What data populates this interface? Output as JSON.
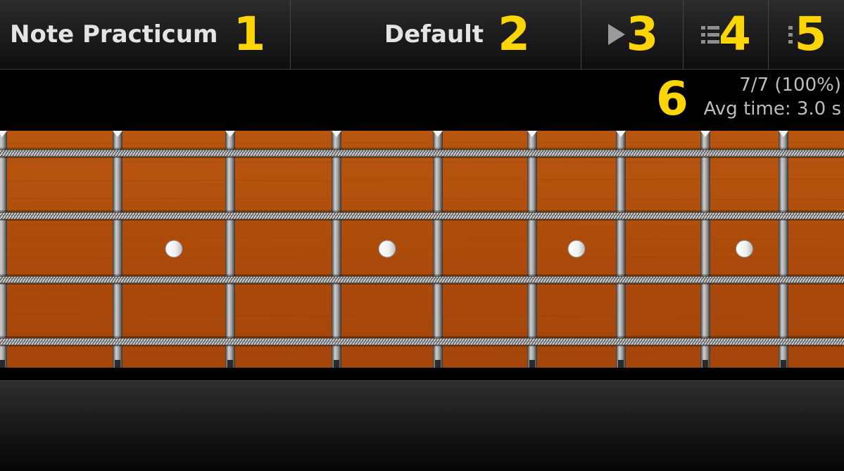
{
  "toolbar": {
    "title": "Note Practicum",
    "title_badge": "1",
    "preset_label": "Default",
    "preset_badge": "2",
    "play_badge": "3",
    "play_icon": "play-icon",
    "list_badge": "4",
    "list_icon": "list-icon",
    "overflow_badge": "5",
    "overflow_icon": "overflow-menu-icon"
  },
  "stats": {
    "badge": "6",
    "score": "7/7 (100%)",
    "avg_time": "Avg time: 3.0 s"
  },
  "fretboard": {
    "strings": 4,
    "inlay_frets": [
      3,
      5,
      7,
      9
    ],
    "colors": {
      "wood": "#b5520f",
      "fret": "#8c8c8c",
      "inlay": "#f2f2f2",
      "string": "#9a9a9a"
    }
  },
  "colors": {
    "badge": "#ffd500",
    "toolbar_text": "#e4e4e4",
    "stats_text": "#bdbdbd"
  }
}
